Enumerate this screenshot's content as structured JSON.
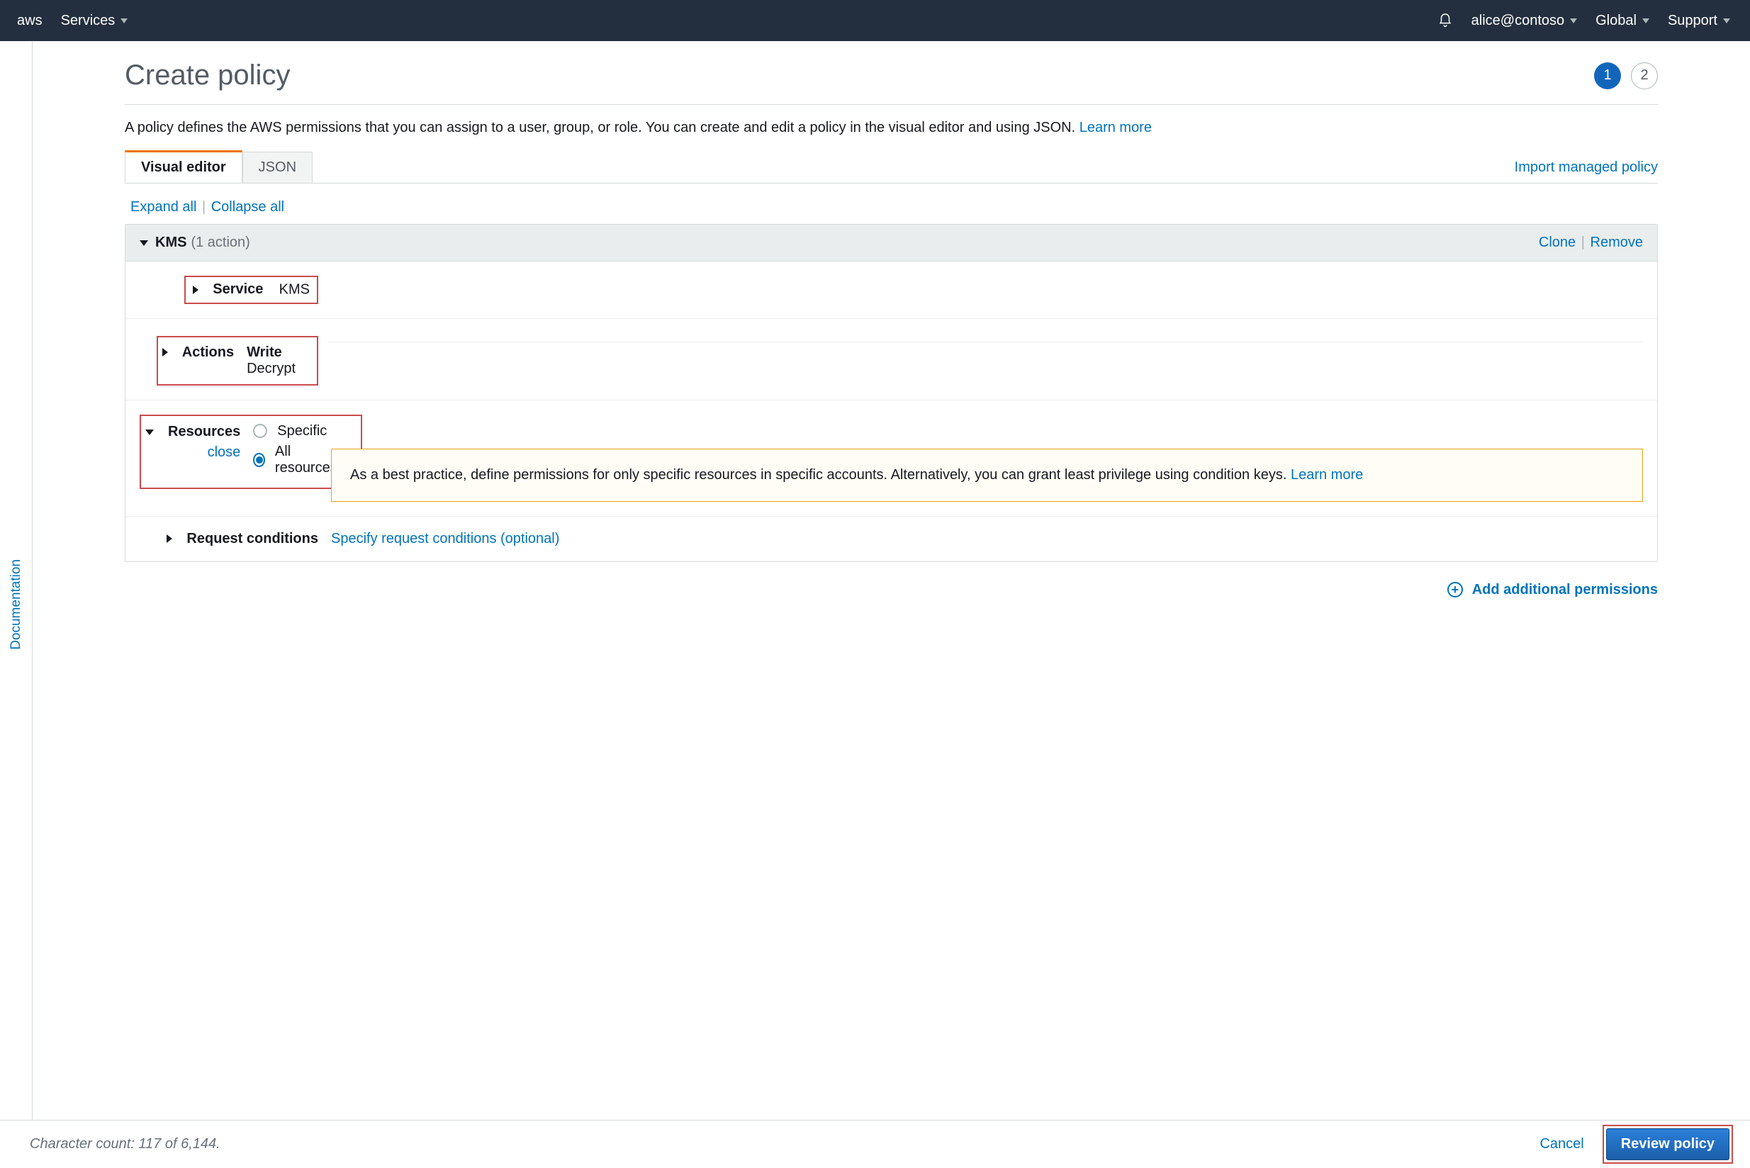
{
  "nav": {
    "services_label": "Services",
    "account_label": "alice@contoso",
    "region_label": "Global",
    "support_label": "Support"
  },
  "side": {
    "documentation_label": "Documentation"
  },
  "header": {
    "title": "Create policy",
    "step1": "1",
    "step2": "2"
  },
  "intro": {
    "text": "A policy defines the AWS permissions that you can assign to a user, group, or role. You can create and edit a policy in the visual editor and using JSON. ",
    "learn_more": "Learn more"
  },
  "tabs": {
    "visual_editor": "Visual editor",
    "json": "JSON",
    "import": "Import managed policy"
  },
  "toolbar": {
    "expand_all": "Expand all",
    "collapse_all": "Collapse all"
  },
  "permission": {
    "service_name": "KMS",
    "action_count": "(1 action)",
    "clone": "Clone",
    "remove": "Remove",
    "rows": {
      "service": {
        "label": "Service",
        "value": "KMS"
      },
      "actions": {
        "label": "Actions",
        "category": "Write",
        "item": "Decrypt"
      },
      "resources": {
        "label": "Resources",
        "close": "close",
        "opt_specific": "Specific",
        "opt_all": "All resources"
      },
      "conditions": {
        "label": "Request conditions",
        "link": "Specify request conditions (optional)"
      }
    },
    "callout": {
      "text": "As a best practice, define permissions for only specific resources in specific accounts. Alternatively, you can grant least privilege using condition keys. ",
      "learn_more": "Learn more"
    }
  },
  "add_permissions_label": "Add additional permissions",
  "footer": {
    "count_text": "Character count: 117 of 6,144.",
    "cancel": "Cancel",
    "review": "Review policy"
  }
}
